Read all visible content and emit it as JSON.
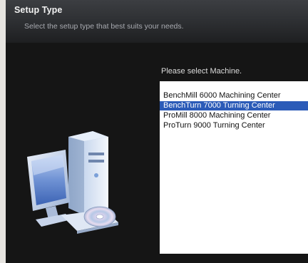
{
  "header": {
    "title": "Setup Type",
    "subtitle": "Select the setup type that best suits your needs."
  },
  "main": {
    "prompt": "Please select Machine.",
    "machines": [
      {
        "label": "BenchMill 6000 Machining Center",
        "selected": false
      },
      {
        "label": "BenchTurn 7000 Turning Center",
        "selected": true
      },
      {
        "label": "ProMill 8000 Machining Center",
        "selected": false
      },
      {
        "label": "ProTurn 9000 Turning Center",
        "selected": false
      }
    ]
  },
  "colors": {
    "header_bg": "#2c2e31",
    "panel_bg": "#151515",
    "selection": "#2b5bb8",
    "page_bg": "#e6e4e0"
  },
  "illustration": {
    "icon": "computer-with-cd-icon"
  }
}
